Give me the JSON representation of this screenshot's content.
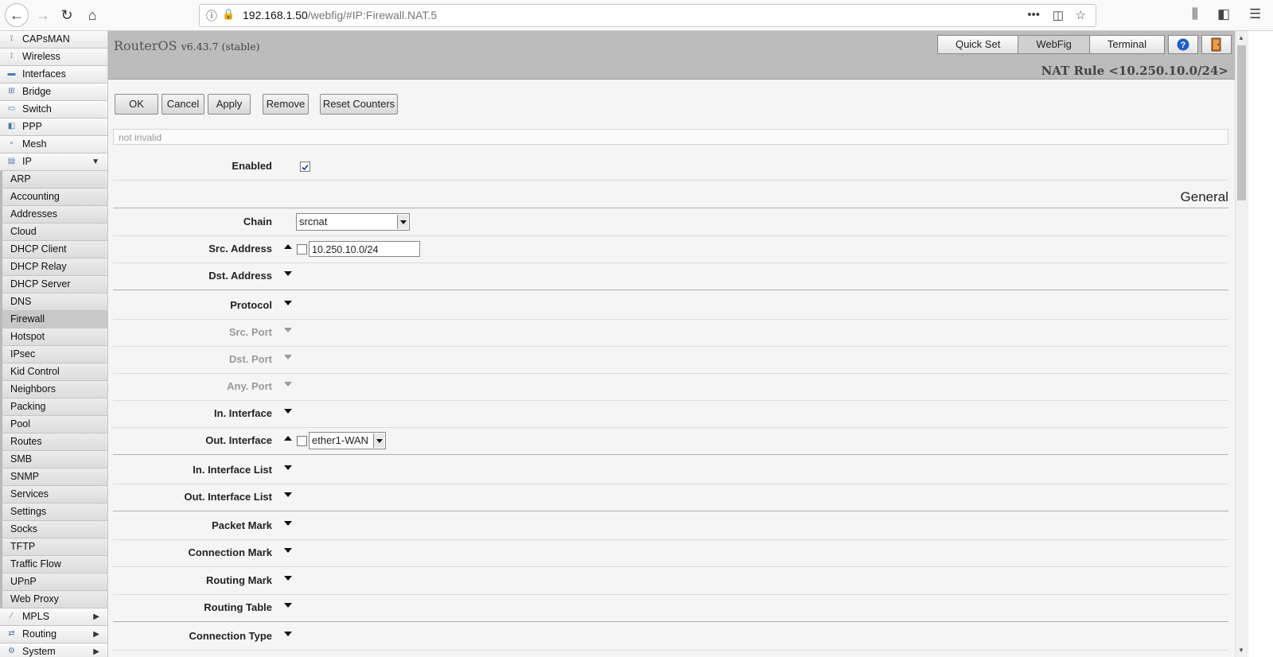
{
  "browser": {
    "url_host": "192.168.1.50",
    "url_path": "/webfig/#IP:Firewall.NAT.5"
  },
  "sidebar": {
    "top_items": [
      {
        "label": "CAPsMAN",
        "icon": "antenna-icon"
      },
      {
        "label": "Wireless",
        "icon": "antenna-icon"
      },
      {
        "label": "Interfaces",
        "icon": "interfaces-icon"
      },
      {
        "label": "Bridge",
        "icon": "bridge-icon"
      },
      {
        "label": "Switch",
        "icon": "switch-icon"
      },
      {
        "label": "PPP",
        "icon": "ppp-icon"
      },
      {
        "label": "Mesh",
        "icon": "mesh-icon"
      },
      {
        "label": "IP",
        "icon": "ip-icon",
        "arrow": "▼"
      }
    ],
    "ip_sub_items": [
      "ARP",
      "Accounting",
      "Addresses",
      "Cloud",
      "DHCP Client",
      "DHCP Relay",
      "DHCP Server",
      "DNS",
      "Firewall",
      "Hotspot",
      "IPsec",
      "Kid Control",
      "Neighbors",
      "Packing",
      "Pool",
      "Routes",
      "SMB",
      "SNMP",
      "Services",
      "Settings",
      "Socks",
      "TFTP",
      "Traffic Flow",
      "UPnP",
      "Web Proxy"
    ],
    "active_sub_item": "Firewall",
    "bottom_items": [
      {
        "label": "MPLS",
        "icon": "mpls-icon",
        "arrow": "▶"
      },
      {
        "label": "Routing",
        "icon": "routing-icon",
        "arrow": "▶"
      },
      {
        "label": "System",
        "icon": "system-icon",
        "arrow": "▶"
      }
    ]
  },
  "header": {
    "product": "RouterOS",
    "version": "v6.43.7 (stable)",
    "modes": [
      "Quick Set",
      "WebFig",
      "Terminal"
    ],
    "active_mode": "WebFig",
    "page_title": "NAT Rule <10.250.10.0/24>"
  },
  "actions": {
    "ok": "OK",
    "cancel": "Cancel",
    "apply": "Apply",
    "remove": "Remove",
    "reset_counters": "Reset Counters"
  },
  "status_text": "not invalid",
  "form": {
    "enabled_label": "Enabled",
    "enabled": true,
    "section_general": "General",
    "chain_label": "Chain",
    "chain_value": "srcnat",
    "src_address_label": "Src. Address",
    "src_address_value": "10.250.10.0/24",
    "dst_address_label": "Dst. Address",
    "protocol_label": "Protocol",
    "src_port_label": "Src. Port",
    "dst_port_label": "Dst. Port",
    "any_port_label": "Any. Port",
    "in_interface_label": "In. Interface",
    "out_interface_label": "Out. Interface",
    "out_interface_value": "ether1-WAN",
    "in_interface_list_label": "In. Interface List",
    "out_interface_list_label": "Out. Interface List",
    "packet_mark_label": "Packet Mark",
    "connection_mark_label": "Connection Mark",
    "routing_mark_label": "Routing Mark",
    "routing_table_label": "Routing Table",
    "connection_type_label": "Connection Type"
  }
}
